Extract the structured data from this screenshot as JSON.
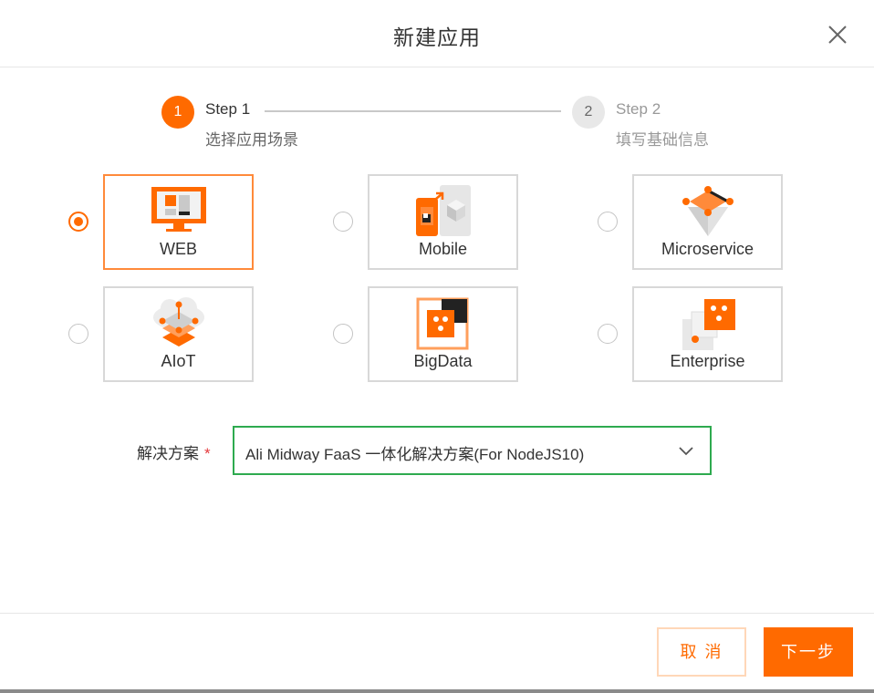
{
  "dialog": {
    "title": "新建应用",
    "close_icon": "close-icon"
  },
  "steps": [
    {
      "number": "1",
      "title": "Step 1",
      "description": "选择应用场景",
      "state": "active"
    },
    {
      "number": "2",
      "title": "Step 2",
      "description": "填写基础信息",
      "state": "pending"
    }
  ],
  "scenarios": [
    {
      "label": "WEB",
      "icon": "web-monitor-icon",
      "selected": true
    },
    {
      "label": "Mobile",
      "icon": "mobile-icon",
      "selected": false
    },
    {
      "label": "Microservice",
      "icon": "microservice-icon",
      "selected": false
    },
    {
      "label": "AIoT",
      "icon": "aiot-icon",
      "selected": false
    },
    {
      "label": "BigData",
      "icon": "bigdata-icon",
      "selected": false
    },
    {
      "label": "Enterprise",
      "icon": "enterprise-icon",
      "selected": false
    }
  ],
  "solution": {
    "label": "解决方案",
    "required_mark": "*",
    "value": "Ali Midway FaaS 一体化解决方案(For NodeJS10)"
  },
  "footer": {
    "cancel_label": "取 消",
    "next_label": "下一步"
  },
  "colors": {
    "accent": "#ff6a00",
    "select_border": "#2eaa4f",
    "required": "#e4393c"
  }
}
